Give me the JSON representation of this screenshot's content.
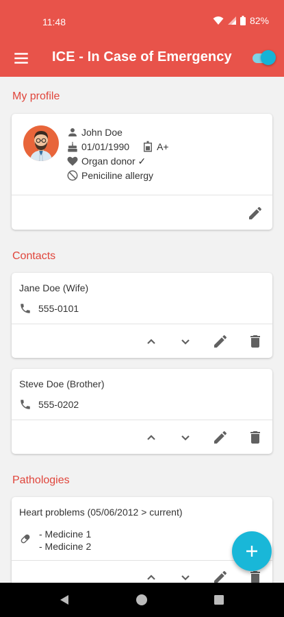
{
  "status": {
    "time": "11:48",
    "battery": "82%",
    "icons": [
      "wifi-icon",
      "signal-icon",
      "battery-icon"
    ]
  },
  "app": {
    "title": "ICE - In Case of Emergency",
    "toggle_on": true,
    "colors": {
      "primary": "#e8534a",
      "accent": "#19b7d8"
    }
  },
  "profile": {
    "section_title": "My profile",
    "name": "John Doe",
    "birthdate": "01/01/1990",
    "blood_type": "A+",
    "organ_donor": "Organ donor ✓",
    "allergy": "Peniciline allergy"
  },
  "contacts": {
    "section_title": "Contacts",
    "items": [
      {
        "name": "Jane Doe (Wife)",
        "phone": "555-0101"
      },
      {
        "name": "Steve Doe (Brother)",
        "phone": "555-0202"
      }
    ]
  },
  "pathologies": {
    "section_title": "Pathologies",
    "items": [
      {
        "title": "Heart problems (05/06/2012 > current)",
        "medicines": [
          "- Medicine 1",
          "- Medicine 2"
        ]
      }
    ]
  }
}
